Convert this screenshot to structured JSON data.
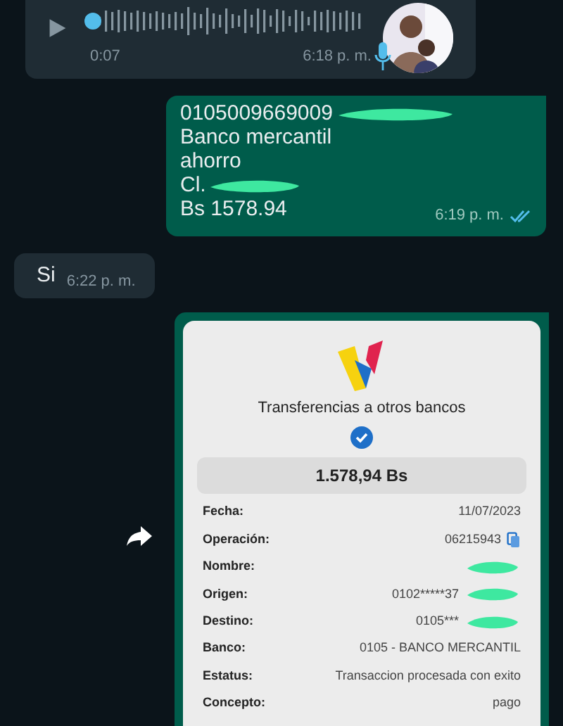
{
  "voice_message": {
    "duration": "0:07",
    "time": "6:18 p. m."
  },
  "outgoing_message": {
    "lines": [
      {
        "text": "0105009669009",
        "redacted": true
      },
      {
        "text": "Banco mercantil",
        "redacted": false
      },
      {
        "text": "ahorro",
        "redacted": false
      },
      {
        "text": "Cl.",
        "redacted": true
      },
      {
        "text": "Bs 1578.94",
        "redacted": false
      }
    ],
    "time": "6:19 p. m.",
    "read": true
  },
  "incoming_message": {
    "text": "Si",
    "time": "6:22 p. m."
  },
  "receipt": {
    "title": "Transferencias a otros bancos",
    "verified": true,
    "amount": "1.578,94 Bs",
    "rows": [
      {
        "label": "Fecha:",
        "value": "11/07/2023",
        "copyable": false,
        "redacted": false
      },
      {
        "label": "Operación:",
        "value": "06215943",
        "copyable": true,
        "redacted": false
      },
      {
        "label": "Nombre:",
        "value": "",
        "copyable": false,
        "redacted": true
      },
      {
        "label": "Origen:",
        "value": "0102*****37",
        "copyable": false,
        "redacted": true
      },
      {
        "label": "Destino:",
        "value": "0105***",
        "copyable": false,
        "redacted": true
      },
      {
        "label": "Banco:",
        "value": "0105 - BANCO MERCANTIL",
        "copyable": false,
        "redacted": false
      },
      {
        "label": "Estatus:",
        "value": "Transaccion procesada con exito",
        "copyable": false,
        "redacted": false
      },
      {
        "label": "Concepto:",
        "value": "pago",
        "copyable": false,
        "redacted": false
      }
    ]
  }
}
